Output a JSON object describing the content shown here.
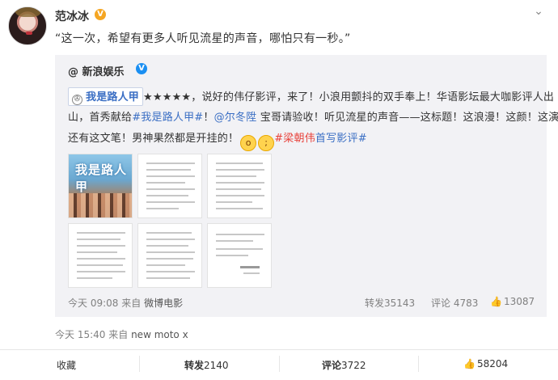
{
  "post": {
    "username": "范冰冰",
    "text": "“这一次，希望有更多人听见流星的声音，哪怕只有一秒。”",
    "time": "今天 15:40",
    "from_label": "来自",
    "device": "new moto x"
  },
  "repost": {
    "author": "@ 新浪娱乐",
    "movie_tag": "我是路人甲",
    "line1_rest": "★★★★★，说好的伟仔影评，来了！小浪用颤抖的双手奉上！华语影坛最大咖影评人出",
    "line2_a": "山，首秀献给",
    "line2_hashtag": "#我是路人甲#",
    "line2_b": "！",
    "line2_mention": "@尔冬陞",
    "line2_c": " 宝哥请验收！听见流星的声音——这标题！这浪漫！这颜！这演技！",
    "line3_a": "还有这文笔！男神果然都是开挂的！",
    "line3_hashtag_red": "#梁朝伟",
    "line3_hashtag_blue": "首写影评#",
    "poster_title": "我是路人甲",
    "time": "今天 09:08",
    "from_label": "来自",
    "source": "微博电影",
    "repost_label": "转发",
    "repost_count": "35143",
    "comment_label": "评论",
    "comment_count": "4783",
    "like_count": "13087"
  },
  "actions": {
    "favorite": "收藏",
    "repost_label": "转发",
    "repost_count": "2140",
    "comment_label": "评论",
    "comment_count": "3722",
    "like_count": "58204"
  },
  "icons": {
    "verified_gold": "verified-badge-icon",
    "verified_blue": "verified-badge-icon",
    "chevron": "chevron-down-icon",
    "thumbs_up": "thumbs-up-icon",
    "film": "film-icon"
  },
  "colors": {
    "link": "#3b6fc4",
    "hashtag_red": "#e8413a",
    "gold_badge": "#f5a623",
    "blue_badge": "#1a8ff2"
  }
}
